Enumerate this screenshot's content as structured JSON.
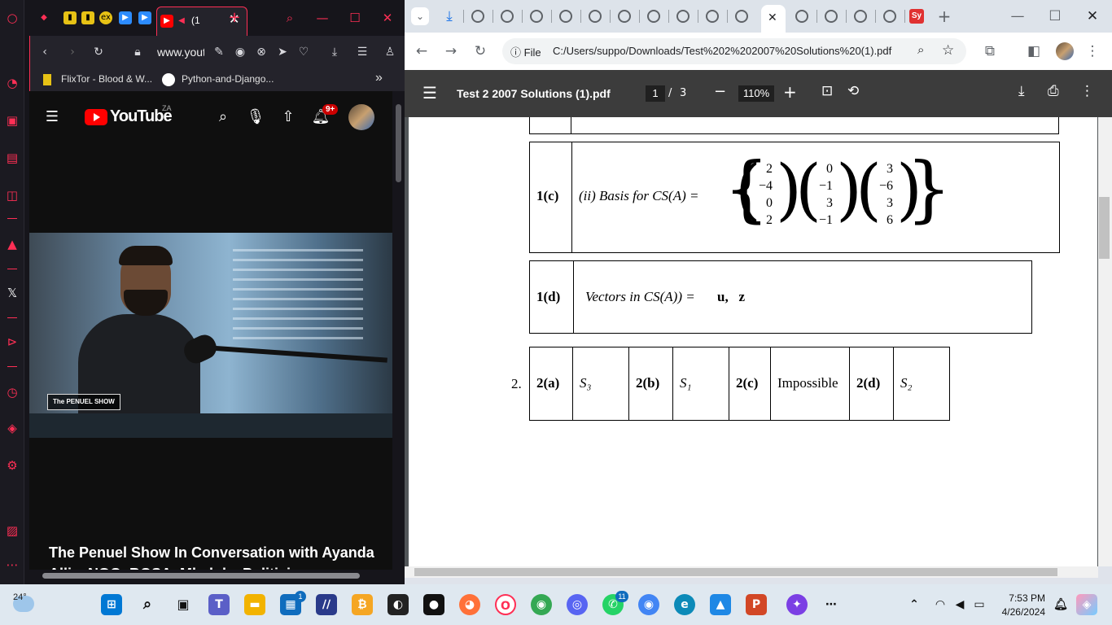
{
  "opera": {
    "tab_active_label": "(1",
    "url": "www.yout",
    "bookmarks": [
      {
        "label": "FlixTor - Blood & W..."
      },
      {
        "label": "Python-and-Django..."
      }
    ],
    "youtube": {
      "logo_text": "YouTube",
      "region": "ZA",
      "notification_count": "9+",
      "show_logo": "The PENUEL SHOW",
      "video_title": "The Penuel Show In Conversation with Ayanda Allie, NGO, BOSA, Mbalula, Politicians vs Bureaucrats"
    }
  },
  "chrome": {
    "omnibox_scheme": "File",
    "url": "C:/Users/suppo/Downloads/Test%202%202007%20Solutions%20(1).pdf",
    "pdf": {
      "file_name": "Test 2 2007 Solutions (1).pdf",
      "current_page": "1",
      "page_sep": "/",
      "total_pages": "3",
      "zoom": "110%",
      "q1c": {
        "label": "1(c)",
        "text": "(ii) Basis for CS(A) =",
        "v1": [
          "2",
          "−4",
          "0",
          "2"
        ],
        "v2": [
          "0",
          "−1",
          "3",
          "−1"
        ],
        "v3": [
          "3",
          "−6",
          "3",
          "6"
        ]
      },
      "q1d": {
        "label": "1(d)",
        "text": "Vectors in CS(A)) =",
        "vectors": "u,   z"
      },
      "q2": {
        "number": "2.",
        "a_label": "2(a)",
        "a_val": "S₃",
        "b_label": "2(b)",
        "b_val": "S₁",
        "c_label": "2(c)",
        "c_val": "Impossible",
        "d_label": "2(d)",
        "d_val": "S₂"
      }
    }
  },
  "taskbar": {
    "weather": "24°",
    "time": "7:53 PM",
    "date": "4/26/2024",
    "badge_store": "1",
    "badge_whatsapp": "11"
  }
}
